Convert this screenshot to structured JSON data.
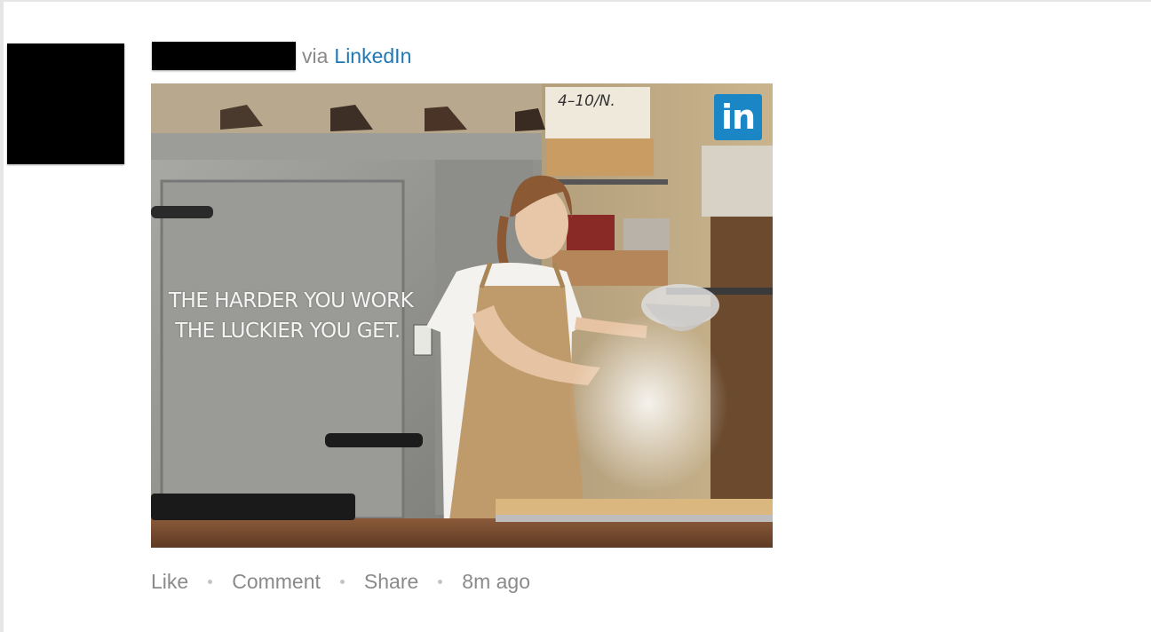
{
  "post": {
    "via_text": "via",
    "source_name": "LinkedIn",
    "image": {
      "overlay_line_1": "THE HARDER YOU WORK",
      "overlay_line_2": "THE LUCKIER YOU GET.",
      "box_label": "4–10/N.",
      "logo_text": "in",
      "logo_color": "#1b86c6"
    },
    "actions": {
      "like": "Like",
      "comment": "Comment",
      "share": "Share",
      "timestamp": "8m ago"
    }
  },
  "colors": {
    "link": "#1f78b4",
    "muted_text": "#8a8a8a"
  }
}
